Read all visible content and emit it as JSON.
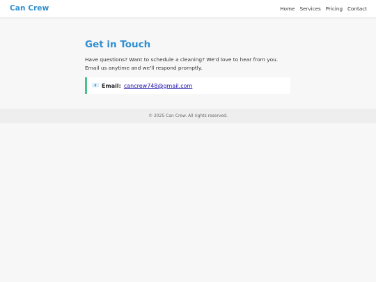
{
  "header": {
    "brand": "Can Crew",
    "nav": [
      "Home",
      "Services",
      "Pricing",
      "Contact"
    ]
  },
  "main": {
    "title": "Get in Touch",
    "lead": "Have questions? Want to schedule a cleaning? We'd love to hear from you. Email us anytime and we'll respond promptly.",
    "contact": {
      "icon": "email-icon",
      "label": "Email:",
      "value": "cancrew748@gmail.com"
    }
  },
  "footer": {
    "text": "© 2025 Can Crew. All rights reserved."
  },
  "colors": {
    "accent": "#2f8fd1",
    "card_border": "#4cc28a",
    "link": "#1a0dab"
  }
}
